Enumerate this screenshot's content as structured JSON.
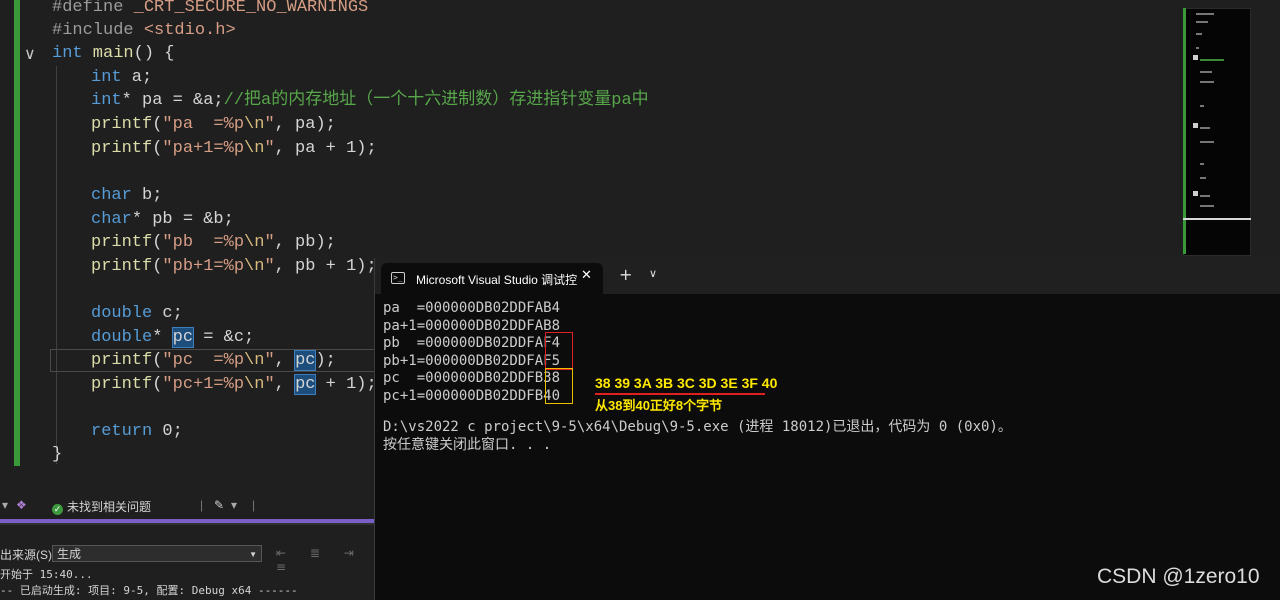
{
  "editor": {
    "fold_glyph": "∨",
    "lines": {
      "l1_pp": "#define",
      "l1_name": " _CRT_SECURE_NO_WARNINGS",
      "l2_pp": "#include",
      "l2_hdr": " <stdio.h>",
      "l3_kw": "int",
      "l3_fn": " main",
      "l3_rest": "() {",
      "l4_kw": "int",
      "l4_var": " a",
      "l4_rest": ";",
      "l5_kw": "int",
      "l5_rest": "* pa = &a;",
      "l5_comment": "//把a的内存地址（一个十六进制数）存进指针变量pa中",
      "l6_fn": "printf",
      "l6_p1": "(",
      "l6_str": "\"pa  =%p",
      "l6_esc": "\\n",
      "l6_str2": "\"",
      "l6_rest": ", pa);",
      "l7_fn": "printf",
      "l7_p1": "(",
      "l7_str": "\"pa+1=%p",
      "l7_esc": "\\n",
      "l7_str2": "\"",
      "l7_rest": ", pa + 1);",
      "l9_kw": "char",
      "l9_var": " b",
      "l9_rest": ";",
      "l10_kw": "char",
      "l10_rest": "* pb = &b;",
      "l11_fn": "printf",
      "l11_p1": "(",
      "l11_str": "\"pb  =%p",
      "l11_esc": "\\n",
      "l11_str2": "\"",
      "l11_rest": ", pb);",
      "l12_fn": "printf",
      "l12_p1": "(",
      "l12_str": "\"pb+1=%p",
      "l12_esc": "\\n",
      "l12_str2": "\"",
      "l12_rest": ", pb + 1);",
      "l14_kw": "double",
      "l14_var": " c",
      "l14_rest": ";",
      "l15_kw": "double",
      "l15_mid": "* ",
      "l15_hl": "pc",
      "l15_rest": " = &c;",
      "l16_fn": "printf",
      "l16_p1": "(",
      "l16_str": "\"pc  =%p",
      "l16_esc": "\\n",
      "l16_str2": "\"",
      "l16_mid": ", ",
      "l16_hl": "pc",
      "l16_rest": ");",
      "l17_fn": "printf",
      "l17_p1": "(",
      "l17_str": "\"pc+1=%p",
      "l17_esc": "\\n",
      "l17_str2": "\"",
      "l17_mid": ", ",
      "l17_hl": "pc",
      "l17_rest": " + 1);",
      "l19_kw": "return",
      "l19_rest": " 0;",
      "l20": "}"
    }
  },
  "issues_bar": {
    "status_text": "未找到相关问题"
  },
  "output_panel": {
    "source_label": "出来源(S):",
    "source_value": "生成",
    "line1": "开始于 15:40...",
    "line2": "-- 已启动生成: 项目: 9-5, 配置: Debug x64 ------"
  },
  "terminal": {
    "tab_title": "Microsoft Visual Studio 调试控",
    "close_glyph": "✕",
    "plus_glyph": "+",
    "dropdown_glyph": "∨",
    "lines": [
      "pa  =000000DB02DDFAB4",
      "pa+1=000000DB02DDFAB8",
      "pb  =000000DB02DDFAF4",
      "pb+1=000000DB02DDFAF5",
      "pc  =000000DB02DDFB38",
      "pc+1=000000DB02DDFB40",
      "",
      "D:\\vs2022 c project\\9-5\\x64\\Debug\\9-5.exe (进程 18012)已退出，代码为 0 (0x0)。",
      "按任意键关闭此窗口. . ."
    ],
    "annotation_hex": "38 39 3A 3B 3C 3D 3E 3F 40",
    "annotation_note": "从38到40正好8个字节"
  },
  "watermark": "CSDN @1zero10",
  "colors": {
    "keyword": "#569cd6",
    "string": "#d69d85",
    "comment": "#57a64a",
    "annotation": "#ffe800",
    "box_red": "#e02020",
    "box_yellow": "#e8c000"
  }
}
